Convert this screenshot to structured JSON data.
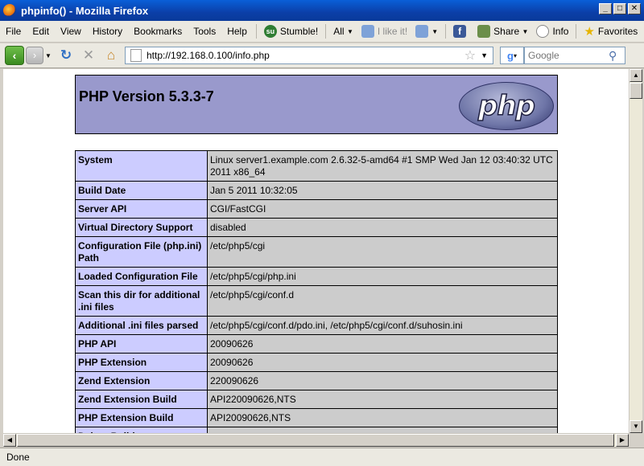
{
  "window": {
    "title": "phpinfo() - Mozilla Firefox"
  },
  "menu": [
    "File",
    "Edit",
    "View",
    "History",
    "Bookmarks",
    "Tools",
    "Help"
  ],
  "toolbar": {
    "stumble": "Stumble!",
    "all": "All",
    "ilike": "I like it!",
    "share": "Share",
    "info": "Info",
    "favorites": "Favorites"
  },
  "nav": {
    "url": "http://192.168.0.100/info.php",
    "search_placeholder": "Google"
  },
  "status": {
    "text": "Done"
  },
  "php": {
    "title": "PHP Version 5.3.3-7",
    "logo_text": "php",
    "rows": [
      {
        "label": "System",
        "value": "Linux server1.example.com 2.6.32-5-amd64 #1 SMP Wed Jan 12 03:40:32 UTC 2011 x86_64"
      },
      {
        "label": "Build Date",
        "value": "Jan 5 2011 10:32:05"
      },
      {
        "label": "Server API",
        "value": "CGI/FastCGI"
      },
      {
        "label": "Virtual Directory Support",
        "value": "disabled"
      },
      {
        "label": "Configuration File (php.ini) Path",
        "value": "/etc/php5/cgi"
      },
      {
        "label": "Loaded Configuration File",
        "value": "/etc/php5/cgi/php.ini"
      },
      {
        "label": "Scan this dir for additional .ini files",
        "value": "/etc/php5/cgi/conf.d"
      },
      {
        "label": "Additional .ini files parsed",
        "value": "/etc/php5/cgi/conf.d/pdo.ini, /etc/php5/cgi/conf.d/suhosin.ini"
      },
      {
        "label": "PHP API",
        "value": "20090626"
      },
      {
        "label": "PHP Extension",
        "value": "20090626"
      },
      {
        "label": "Zend Extension",
        "value": "220090626"
      },
      {
        "label": "Zend Extension Build",
        "value": "API220090626,NTS"
      },
      {
        "label": "PHP Extension Build",
        "value": "API20090626,NTS"
      },
      {
        "label": "Debug Build",
        "value": "no"
      }
    ]
  }
}
